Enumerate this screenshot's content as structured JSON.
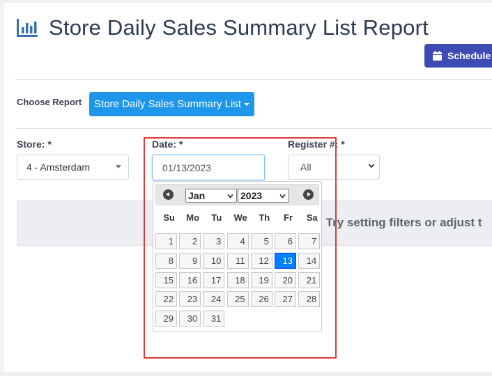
{
  "page": {
    "title": "Store Daily Sales Summary List Report",
    "schedule_label": "Schedule R"
  },
  "report": {
    "choose_label": "Choose Report",
    "selected": "Store Daily Sales Summary List"
  },
  "filters": {
    "store": {
      "label": "Store: *",
      "value": "4 - Amsterdam"
    },
    "date": {
      "label": "Date: *",
      "value": "01/13/2023"
    },
    "register": {
      "label": "Register #: *",
      "value": "All"
    }
  },
  "info": {
    "text": "y. Try setting filters or adjust t"
  },
  "datepicker": {
    "month": "Jan",
    "year": "2023",
    "weekdays": [
      "Su",
      "Mo",
      "Tu",
      "We",
      "Th",
      "Fr",
      "Sa"
    ],
    "first_weekday_index": 0,
    "days_in_month": 31,
    "selected_day": 13
  },
  "colors": {
    "accent": "#1e96ea",
    "schedule": "#3e4bb5",
    "selected_day": "#007fff",
    "highlight_box": "#e03a3a"
  },
  "icons": {
    "title": "bar-chart-icon",
    "schedule": "calendar-icon"
  }
}
